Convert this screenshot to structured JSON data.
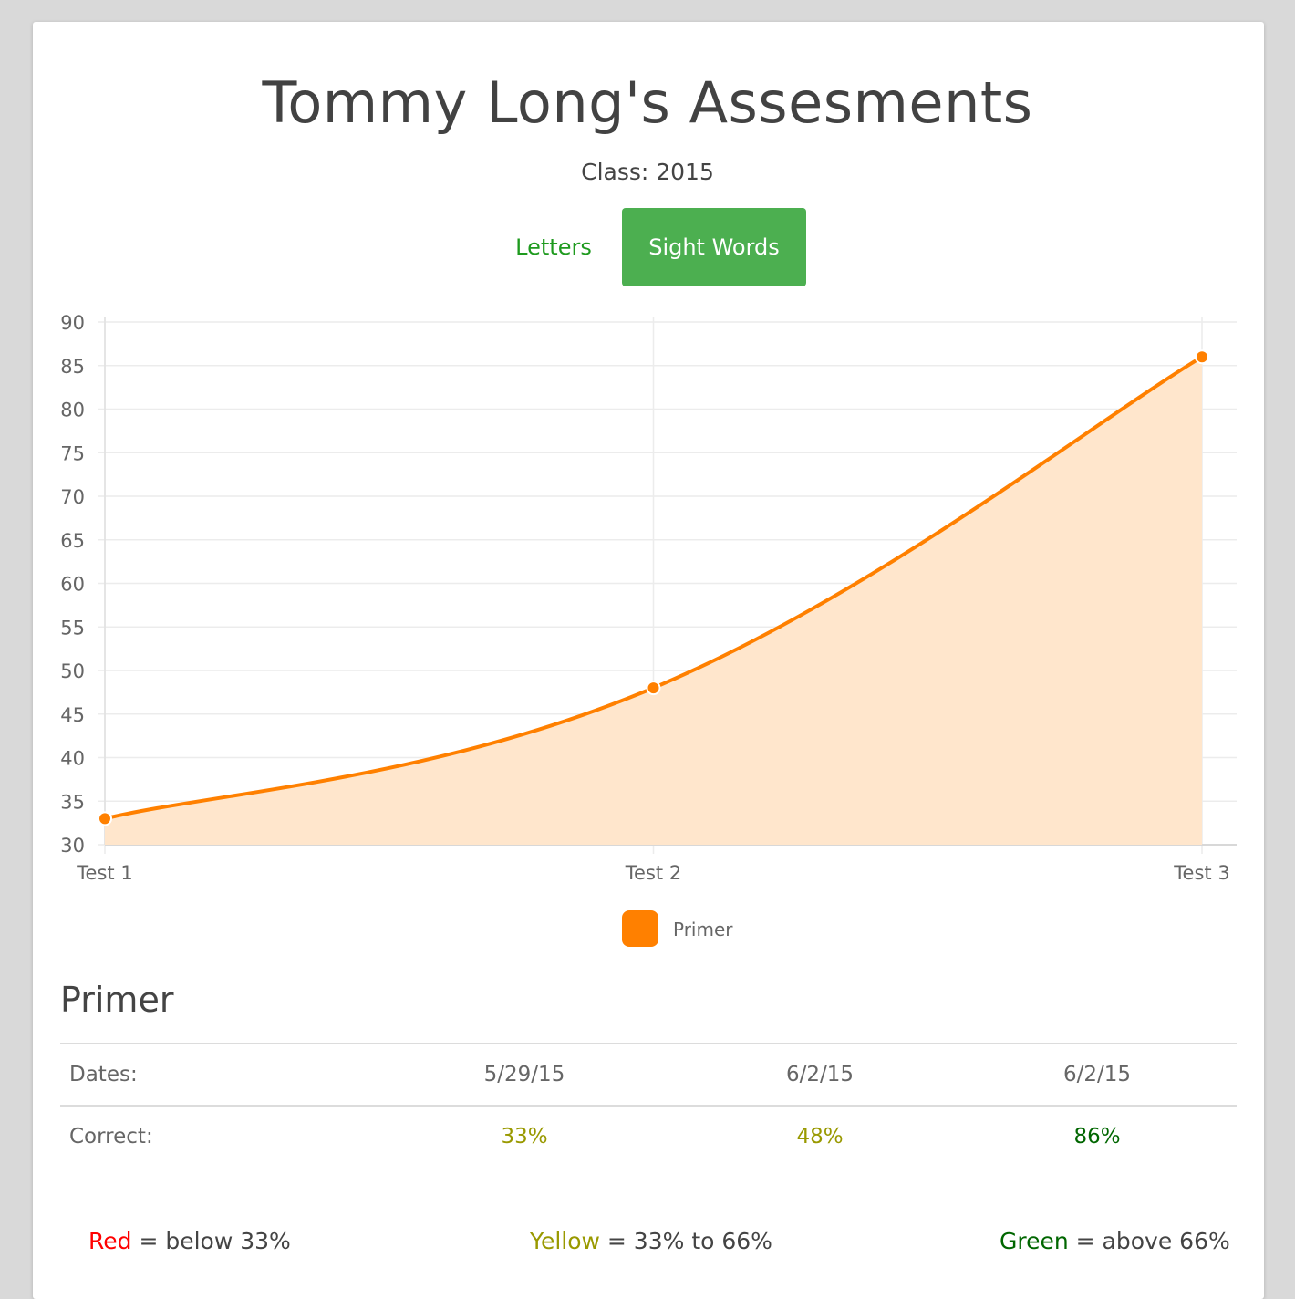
{
  "header": {
    "title": "Tommy Long's Assesments",
    "subtitle": "Class: 2015"
  },
  "tabs": [
    {
      "label": "Letters",
      "active": false
    },
    {
      "label": "Sight Words",
      "active": true
    }
  ],
  "colors": {
    "accent_green": "#4caf50",
    "series_line": "#ff8000",
    "series_fill": "#ffe6cc",
    "red": "#ff0000",
    "yellow": "#999900",
    "green": "#006600"
  },
  "chart_data": {
    "type": "area",
    "categories": [
      "Test 1",
      "Test 2",
      "Test 3"
    ],
    "series": [
      {
        "name": "Primer",
        "values": [
          33,
          48,
          86
        ]
      }
    ],
    "ylim": [
      30,
      90
    ],
    "yticks": [
      "90",
      "85",
      "80",
      "75",
      "70",
      "65",
      "60",
      "55",
      "50",
      "45",
      "40",
      "35",
      "30"
    ],
    "grid": true,
    "legend_position": "bottom-center"
  },
  "legend": {
    "label": "Primer"
  },
  "table": {
    "title": "Primer",
    "rows": [
      {
        "label": "Dates:",
        "values": [
          "5/29/15",
          "6/2/15",
          "6/2/15"
        ]
      },
      {
        "label": "Correct:",
        "values": [
          "33%",
          "48%",
          "86%"
        ],
        "colors": [
          "#999900",
          "#999900",
          "#006600"
        ]
      }
    ]
  },
  "scale": [
    {
      "name": "Red",
      "desc": " = below 33%"
    },
    {
      "name": "Yellow",
      "desc": " = 33% to 66%"
    },
    {
      "name": "Green",
      "desc": " = above 66%"
    }
  ]
}
